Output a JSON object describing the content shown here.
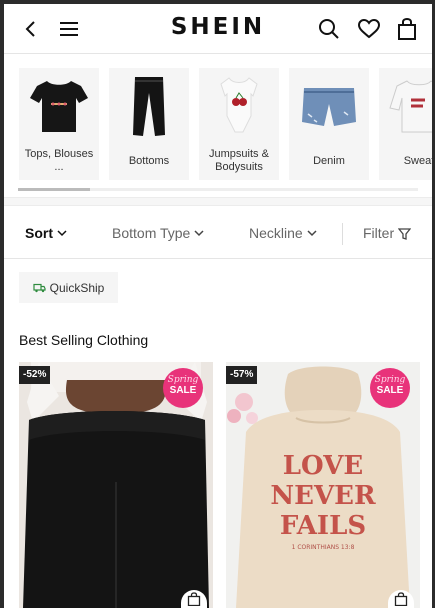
{
  "header": {
    "logo": "SHEIN",
    "icons": [
      "back-icon",
      "menu-icon",
      "search-icon",
      "heart-icon",
      "bag-icon"
    ]
  },
  "categories": [
    {
      "label": "Tops, Blouses ..."
    },
    {
      "label": "Bottoms"
    },
    {
      "label": "Jumpsuits & Bodysuits"
    },
    {
      "label": "Denim"
    },
    {
      "label": "Sweat"
    }
  ],
  "filters": {
    "sort": "Sort",
    "bottom_type": "Bottom Type",
    "neckline": "Neckline",
    "filter": "Filter"
  },
  "quickship": "QuickShip",
  "section_title": "Best Selling Clothing",
  "products": [
    {
      "discount": "-52%",
      "badge_top": "Spring",
      "badge_bottom": "SALE"
    },
    {
      "discount": "-57%",
      "badge_top": "Spring",
      "badge_bottom": "SALE",
      "print_lines": [
        "LOVE",
        "NEVER",
        "FAILS"
      ],
      "print_sub": "1 CORINTHIANS 13:8"
    }
  ],
  "colors": {
    "sale_badge": "#e8337a",
    "discount_badge": "#222222",
    "print_red": "#c4534a",
    "hoodie": "#ecdcc6"
  }
}
